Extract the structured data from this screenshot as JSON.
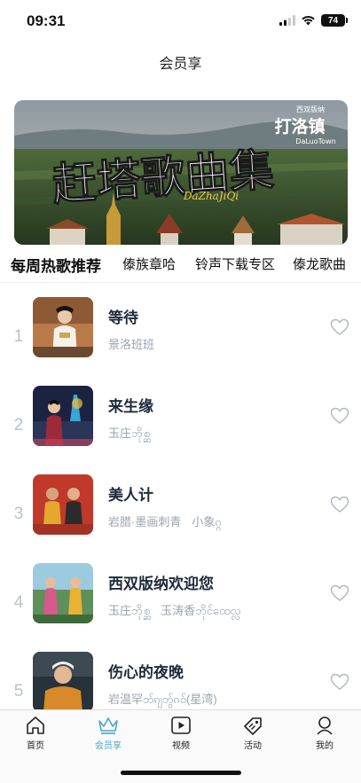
{
  "status_bar": {
    "time": "09:31",
    "battery": "74"
  },
  "nav": {
    "title": "会员享"
  },
  "banner": {
    "title": "赶塔歌曲集",
    "subtitle": "DaZhaJiQi",
    "brand_top": "西双版纳",
    "brand_main": "打洛镇",
    "brand_en": "DaLuoTown"
  },
  "tabs": [
    "每周热歌推荐",
    "傣族章哈",
    "铃声下载专区",
    "傣龙歌曲"
  ],
  "songs": [
    {
      "rank": "1",
      "title": "等待",
      "artists": [
        "景洛班班"
      ]
    },
    {
      "rank": "2",
      "title": "来生缘",
      "artists": [
        "玉庄ဘိုစ္ဆ"
      ]
    },
    {
      "rank": "3",
      "title": "美人计",
      "artists": [
        "岩腊·墨画刺青",
        "小象ၵ္ဂ"
      ]
    },
    {
      "rank": "4",
      "title": "西双版纳欢迎您",
      "artists": [
        "玉庄ဘိုစ္ဆ",
        "玉涛香ဘိုင်ထေလ္လ"
      ]
    },
    {
      "rank": "5",
      "title": "伤心的夜晚",
      "artists": [
        "岩温罕ဘ်ၵျဘွ်ၵဝ်(星湾)"
      ]
    }
  ],
  "tab_bar": {
    "items": [
      {
        "label": "首页",
        "icon": "home-icon",
        "active": false
      },
      {
        "label": "会员享",
        "icon": "crown-icon",
        "active": true
      },
      {
        "label": "视频",
        "icon": "video-play-icon",
        "active": false
      },
      {
        "label": "活动",
        "icon": "tag-icon",
        "active": false
      },
      {
        "label": "我的",
        "icon": "profile-icon",
        "active": false
      }
    ]
  },
  "colors": {
    "accent": "#4aa6c9",
    "rank": "#b9c1cc",
    "artist": "#9aa3b0",
    "title": "#1f2a3a"
  }
}
